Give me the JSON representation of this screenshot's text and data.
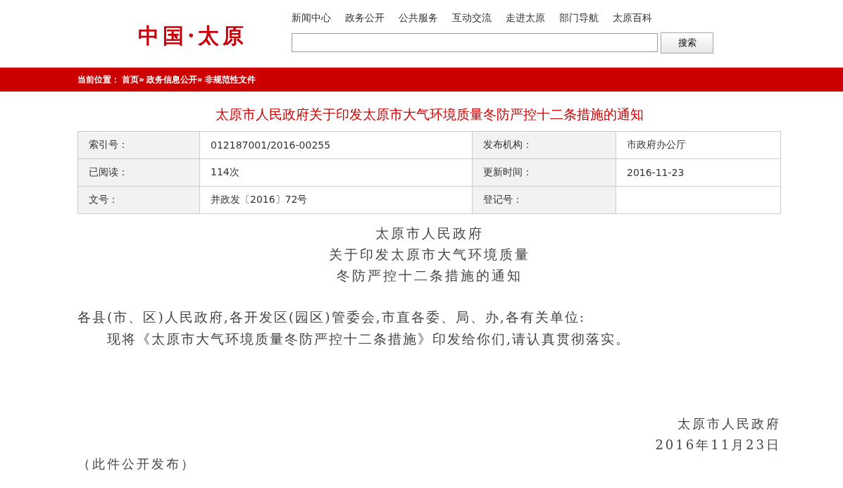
{
  "header": {
    "logo": "中国·太原",
    "nav": [
      "新闻中心",
      "政务公开",
      "公共服务",
      "互动交流",
      "走进太原",
      "部门导航",
      "太原百科"
    ],
    "search": {
      "button": "搜索"
    }
  },
  "breadcrumb": {
    "label": "当前位置：",
    "items": [
      "首页»",
      "政务信息公开»",
      "非规范性文件"
    ]
  },
  "article": {
    "title": "太原市人民政府关于印发太原市大气环境质量冬防严控十二条措施的通知",
    "meta": [
      {
        "label": "索引号：",
        "value": "012187001/2016-00255",
        "label_2": "发布机构：",
        "value_2": "市政府办公厅"
      },
      {
        "label": "已阅读：",
        "value": "114次",
        "label_2": "更新时间：",
        "value_2": "2016-11-23"
      },
      {
        "label": "文号：",
        "value": "并政发〔2016〕72号",
        "label_2": "登记号："
      }
    ],
    "doc_heading": [
      "太原市人民政府",
      "关于印发太原市大气环境质量",
      "冬防严控十二条措施的通知"
    ],
    "addressee": "各县(市、区)人民政府,各开发区(园区)管委会,市直各委、局、办,各有关单位:",
    "body": "现将《太原市大气环境质量冬防严控十二条措施》印发给你们,请认真贯彻落实。",
    "signature": [
      "太原市人民政府",
      "2016年11月23日"
    ],
    "note": "（此件公开发布）"
  }
}
